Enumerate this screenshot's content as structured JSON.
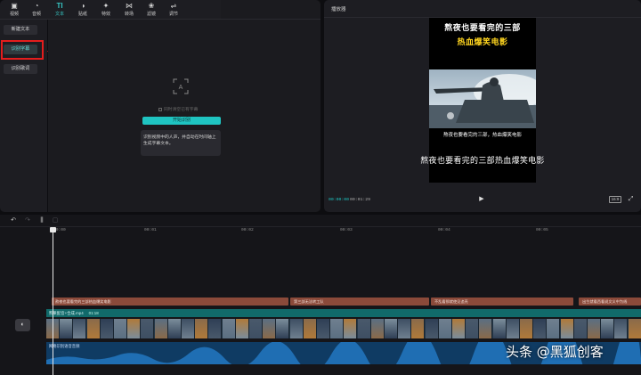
{
  "toolbar": {
    "items": [
      {
        "label": "视频",
        "icon": "video-icon",
        "glyph": "▣"
      },
      {
        "label": "音频",
        "icon": "audio-icon",
        "glyph": "◔"
      },
      {
        "label": "文本",
        "icon": "text-icon",
        "glyph": "TI"
      },
      {
        "label": "贴纸",
        "icon": "sticker-icon",
        "glyph": "◑"
      },
      {
        "label": "特效",
        "icon": "effects-icon",
        "glyph": "✦"
      },
      {
        "label": "转场",
        "icon": "transition-icon",
        "glyph": "⋈"
      },
      {
        "label": "滤镜",
        "icon": "filter-icon",
        "glyph": "❀"
      },
      {
        "label": "调节",
        "icon": "adjust-icon",
        "glyph": "⇌"
      }
    ],
    "active": "文本"
  },
  "left_panel": {
    "new_text": "新建文本",
    "recognize_subtitles": "识别字幕",
    "recognize_lyrics": "识别歌词"
  },
  "recognize": {
    "option_label": "同时清空已有字幕",
    "start_button": "开始识别",
    "description": "识别视频中的人声，并自动在时间轴上生成字幕文本。"
  },
  "player": {
    "title": "播放器",
    "video_title_line1": "熬夜也要看完的三部",
    "video_title_line2": "热血爆笑电影",
    "caption_small": "熬夜也要看完的三部，热血爆笑电影",
    "subtitle": "熬夜也要看完的三部热血爆笑电影",
    "time_current": "00:00:00",
    "time_total": "00:01:29",
    "ratio": "16:9"
  },
  "timeline": {
    "ticks": [
      "00:00",
      "00:01",
      "00:02",
      "00:03",
      "00:04",
      "00:05"
    ],
    "subtitle_clips": [
      "熬夜也要看完的三部热血爆笑电影",
      "第三部无法转工队",
      "不乱看那就使见追亮",
      "出生就看西看说文义中为线"
    ],
    "audio_track_name": "熊果配音+合成.mp4",
    "audio_track_duration": "01:18",
    "voice_track_name": "网络识别语音音频",
    "accent_color": "#1fc4c1"
  },
  "watermark": "头条 @黑狐创客"
}
